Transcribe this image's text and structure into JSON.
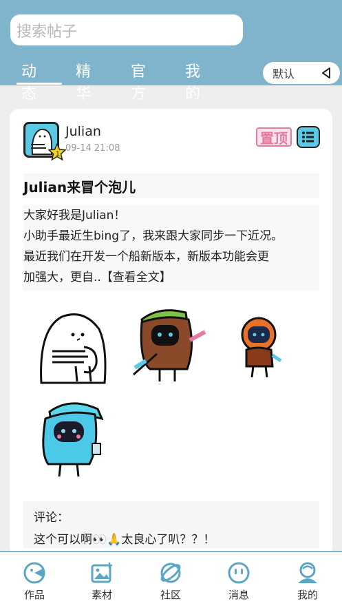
{
  "search": {
    "placeholder": "搜索帖子"
  },
  "tabs": [
    "动态",
    "精华",
    "官方",
    "我的"
  ],
  "sort": {
    "label": "默认"
  },
  "post": {
    "author": "Julian",
    "time": "09-14 21:08",
    "pin_label": "置顶",
    "title": "Julian来冒个泡儿",
    "body_lines": [
      "大家好我是Julian！",
      "小助手最近生bing了，我来跟大家同步一下近况。",
      "最近我们在开发一个船新版本，新版本功能会更",
      "加强大，更自..【查看全文】"
    ],
    "images": [
      "ghost-sticker",
      "brown-hooded-sticker",
      "orange-hooded-sticker",
      "blue-hooded-sticker"
    ],
    "comment_label": "评论：",
    "comment_text": "这个可以啊👀🙏太良心了叭？？！"
  },
  "nav": [
    {
      "label": "作品",
      "icon": "works-icon"
    },
    {
      "label": "素材",
      "icon": "material-icon"
    },
    {
      "label": "社区",
      "icon": "community-icon"
    },
    {
      "label": "消息",
      "icon": "message-icon"
    },
    {
      "label": "我的",
      "icon": "profile-icon"
    }
  ],
  "colors": {
    "header": "#7fb4cc",
    "accent": "#5bc8e6",
    "pin": "#e37aa0"
  }
}
